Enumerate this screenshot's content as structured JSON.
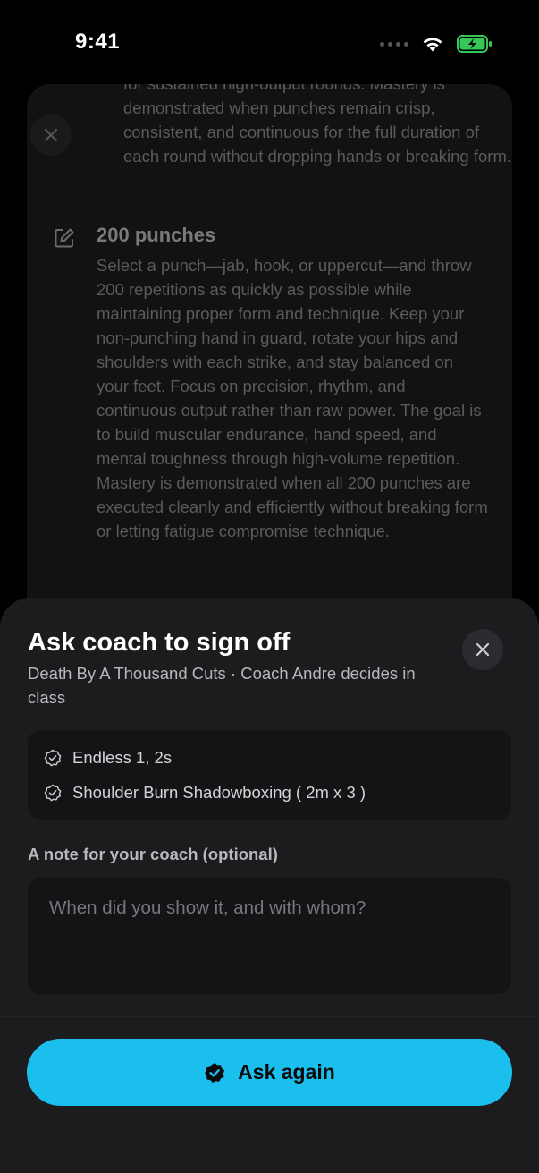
{
  "status_bar": {
    "time": "9:41"
  },
  "background": {
    "top_text": "for sustained high-output rounds. Mastery is demonstrated when punches remain crisp, consistent, and continuous for the full duration of each round without dropping hands or breaking form.",
    "item": {
      "title": "200 punches",
      "description": "Select a punch—jab, hook, or uppercut—and throw 200 repetitions as quickly as possible while maintaining proper form and technique. Keep your non-punching hand in guard, rotate your hips and shoulders with each strike, and stay balanced on your feet. Focus on precision, rhythm, and continuous output rather than raw power. The goal is to build muscular endurance, hand speed, and mental toughness through high-volume repetition. Mastery is demonstrated when all 200 punches are executed cleanly and efficiently without breaking form or letting fatigue compromise technique."
    }
  },
  "sheet": {
    "title": "Ask coach to sign off",
    "subtitle": "Death By A Thousand Cuts · Coach Andre decides in class",
    "skills": [
      {
        "label": "Endless 1, 2s",
        "icon": "verified-badge-icon"
      },
      {
        "label": "Shoulder Burn Shadowboxing ( 2m x 3 )",
        "icon": "verified-badge-icon"
      }
    ],
    "note_label": "A note for your coach (optional)",
    "note_placeholder": "When did you show it, and with whom?",
    "note_value": "",
    "button_label": "Ask again"
  },
  "colors": {
    "accent": "#1bbfee",
    "sheet_bg": "#1c1c1e",
    "battery": "#34c759"
  }
}
